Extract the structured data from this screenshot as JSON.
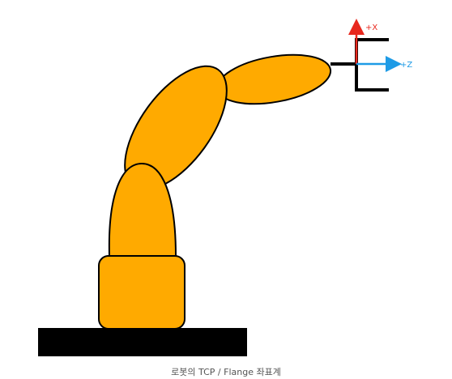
{
  "colors": {
    "robot_fill": "#FFAA00",
    "outline": "#000000",
    "base": "#000000",
    "x_axis": "#E8281E",
    "z_axis": "#1E9BE6",
    "caption": "#555555"
  },
  "axes": {
    "x_label": "+X",
    "z_label": "+Z"
  },
  "caption": "로봇의 TCP / Flange 좌표계"
}
